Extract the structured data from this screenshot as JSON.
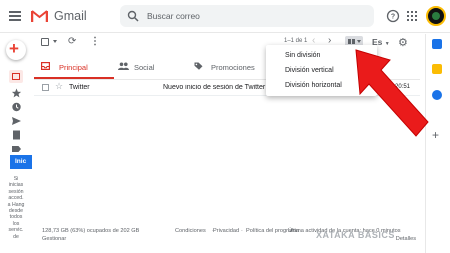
{
  "header": {
    "app_name": "Gmail",
    "search_placeholder": "Buscar correo"
  },
  "left_rail": {
    "hangouts_button": "Inic",
    "hangouts_text": "Si inicias sesión acced. a Hang desde todos los servic. de"
  },
  "toolbar": {
    "pager": "1–1 de 1",
    "language": "Es"
  },
  "tabs": [
    {
      "label": "Principal",
      "active": true
    },
    {
      "label": "Social",
      "active": false
    },
    {
      "label": "Promociones",
      "active": false
    }
  ],
  "emails": [
    {
      "from": "Twitter",
      "subject": "Nuevo inicio de sesión de Twitter",
      "time": "20:51"
    }
  ],
  "split_menu": {
    "items": [
      "Sin división",
      "División vertical",
      "División horizontal"
    ]
  },
  "footer": {
    "storage": "128,73 GB (63%) ocupados de 202 GB",
    "manage": "Gestionar",
    "terms": "Condiciones",
    "privacy": "Privacidad",
    "policy": "Política del programa",
    "activity": "Última actividad de la cuenta: hace 0 minutos",
    "details": "Detalles"
  },
  "watermark": "XATAKA BASICS",
  "colors": {
    "accent_red": "#d93025",
    "arrow_red": "#ea1b1b",
    "blue": "#1a73e8"
  }
}
